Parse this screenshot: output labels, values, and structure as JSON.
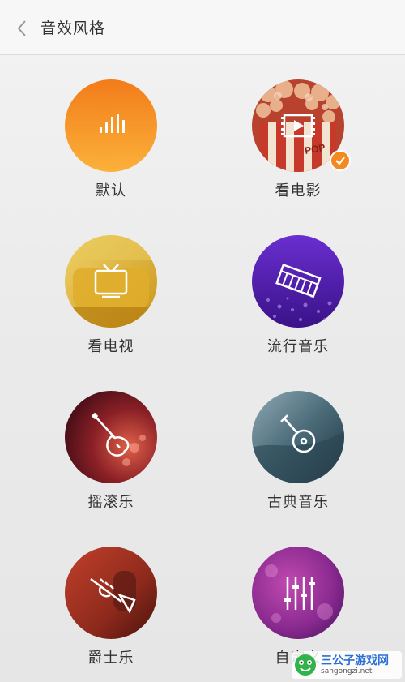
{
  "header": {
    "title": "音效风格",
    "back_icon": "chevron-left-icon"
  },
  "styles": [
    {
      "label": "默认",
      "icon": "equalizer-bars-icon",
      "selected": false
    },
    {
      "label": "看电影",
      "icon": "film-play-icon",
      "selected": true
    },
    {
      "label": "看电视",
      "icon": "tv-icon",
      "selected": false
    },
    {
      "label": "流行音乐",
      "icon": "keyboard-icon",
      "selected": false
    },
    {
      "label": "摇滚乐",
      "icon": "electric-guitar-icon",
      "selected": false
    },
    {
      "label": "古典音乐",
      "icon": "ruan-lute-icon",
      "selected": false
    },
    {
      "label": "爵士乐",
      "icon": "trumpet-icon",
      "selected": false
    },
    {
      "label": "自定义",
      "icon": "sliders-icon",
      "selected": false
    }
  ],
  "watermark": {
    "title": "三公子游戏网",
    "url": "sangongzi.net"
  },
  "colors": {
    "accent": "#f38a1f",
    "text": "#333333"
  }
}
